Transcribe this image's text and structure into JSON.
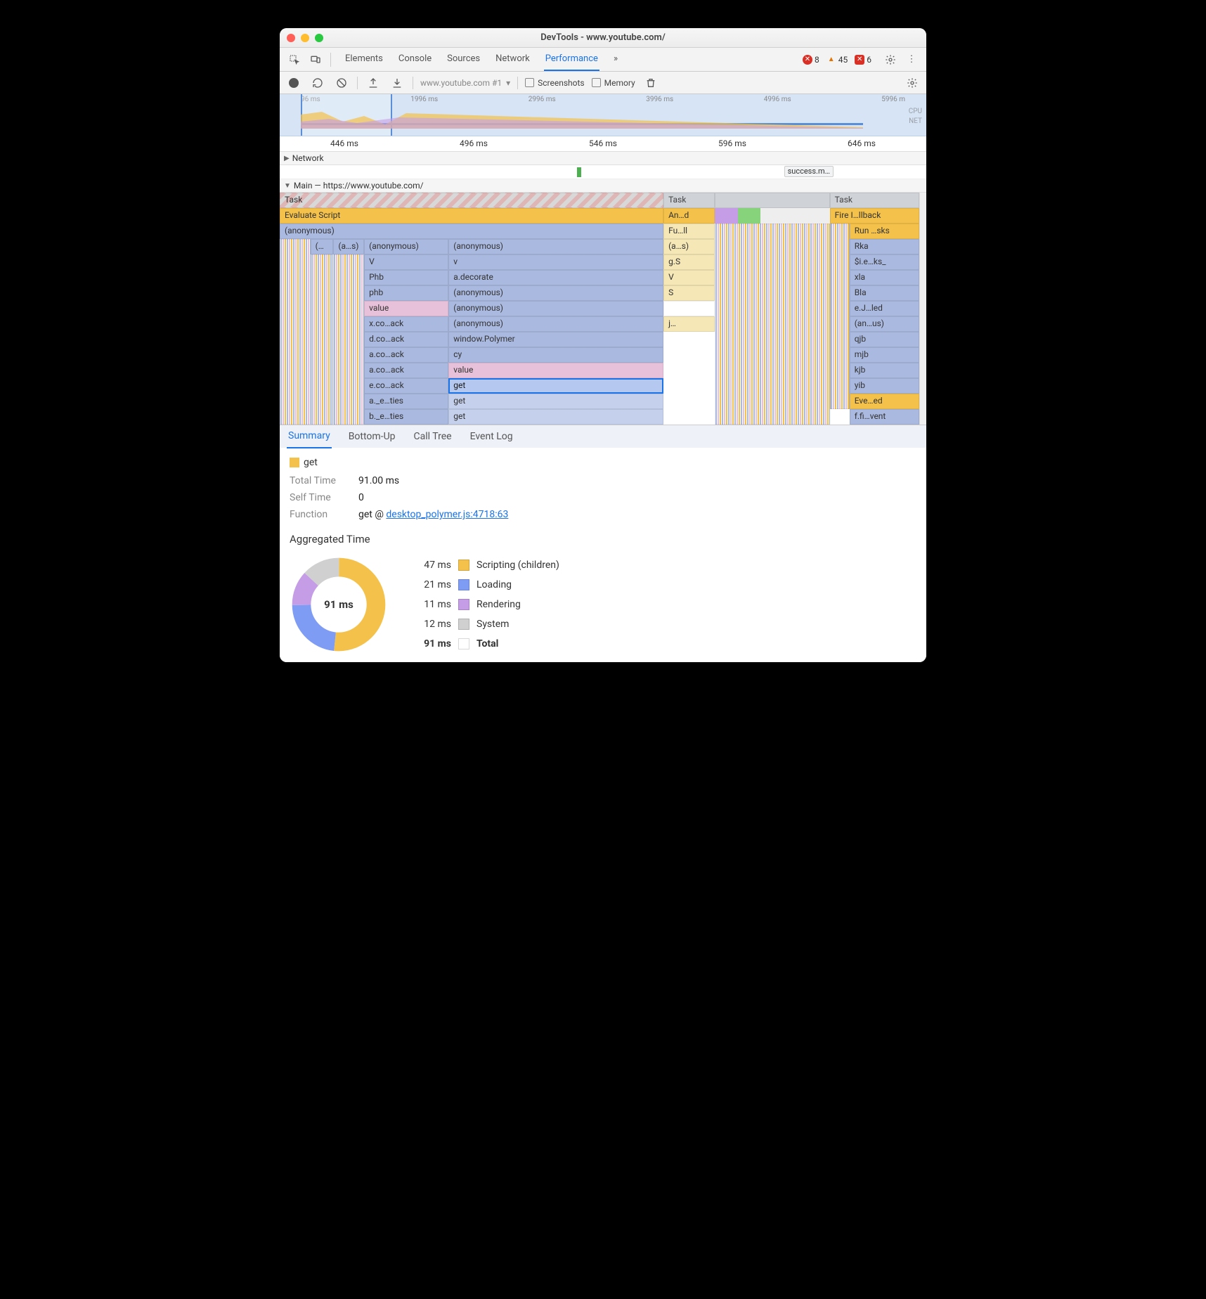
{
  "window": {
    "title": "DevTools - www.youtube.com/"
  },
  "tabs": {
    "items": [
      "Elements",
      "Console",
      "Sources",
      "Network",
      "Performance"
    ],
    "active": "Performance",
    "more": "»"
  },
  "badges": {
    "errors": "8",
    "warnings": "45",
    "console_errors": "6"
  },
  "toolbar": {
    "profile_name": "www.youtube.com #1",
    "screenshots_label": "Screenshots",
    "memory_label": "Memory"
  },
  "overview": {
    "ticks": [
      "96 ms",
      "1996 ms",
      "2996 ms",
      "3996 ms",
      "4996 ms",
      "5996 m"
    ],
    "cpu_label": "CPU",
    "net_label": "NET"
  },
  "ruler": {
    "ticks": [
      "446 ms",
      "496 ms",
      "546 ms",
      "596 ms",
      "646 ms"
    ]
  },
  "tracks": {
    "network_label": "Network",
    "main_label": "Main — https://www.youtube.com/",
    "network_chip": "success.m…"
  },
  "flame": {
    "col1": {
      "task": "Task",
      "eval": "Evaluate Script",
      "anon": "(anonymous)",
      "anon_short1": "(…",
      "anon_short2": "(a…s)",
      "stack_a": [
        {
          "label": "(anonymous)",
          "cls": "c-blue"
        },
        {
          "label": "V",
          "cls": "c-blue"
        },
        {
          "label": "Phb",
          "cls": "c-blue"
        },
        {
          "label": "phb",
          "cls": "c-blue"
        },
        {
          "label": "value",
          "cls": "c-pink"
        },
        {
          "label": "x.co…ack",
          "cls": "c-blue"
        },
        {
          "label": "d.co…ack",
          "cls": "c-blue"
        },
        {
          "label": "a.co…ack",
          "cls": "c-blue"
        },
        {
          "label": "a.co…ack",
          "cls": "c-blue"
        },
        {
          "label": "e.co…ack",
          "cls": "c-blue"
        },
        {
          "label": "a._e…ties",
          "cls": "c-blue"
        },
        {
          "label": "b._e…ties",
          "cls": "c-blue"
        }
      ],
      "stack_b": [
        {
          "label": "(anonymous)",
          "cls": "c-blue"
        },
        {
          "label": "v",
          "cls": "c-blue"
        },
        {
          "label": "a.decorate",
          "cls": "c-blue"
        },
        {
          "label": "(anonymous)",
          "cls": "c-blue"
        },
        {
          "label": "(anonymous)",
          "cls": "c-blue"
        },
        {
          "label": "(anonymous)",
          "cls": "c-blue"
        },
        {
          "label": "window.Polymer",
          "cls": "c-blue"
        },
        {
          "label": "cy",
          "cls": "c-blue"
        },
        {
          "label": "value",
          "cls": "c-pink"
        },
        {
          "label": "get",
          "cls": "c-sel"
        },
        {
          "label": "get",
          "cls": "c-lightblue"
        },
        {
          "label": "get",
          "cls": "c-lightblue"
        }
      ]
    },
    "col2": {
      "task": "Task",
      "and": "An…d",
      "full": "Fu…ll",
      "stack": [
        "(a…s)",
        "g.S",
        "V",
        "S"
      ],
      "j": "j…"
    },
    "col3": {
      "task": "Task",
      "fire": "Fire I…llback",
      "run": "Run …sks",
      "stack": [
        {
          "label": "Rka",
          "cls": "c-blue"
        },
        {
          "label": "$i.e…ks_",
          "cls": "c-blue"
        },
        {
          "label": "xla",
          "cls": "c-blue"
        },
        {
          "label": "Bla",
          "cls": "c-blue"
        },
        {
          "label": "e.J…led",
          "cls": "c-blue"
        },
        {
          "label": "(an…us)",
          "cls": "c-blue"
        },
        {
          "label": "qjb",
          "cls": "c-blue"
        },
        {
          "label": "mjb",
          "cls": "c-blue"
        },
        {
          "label": "kjb",
          "cls": "c-blue"
        },
        {
          "label": "yib",
          "cls": "c-blue"
        },
        {
          "label": "Eve…ed",
          "cls": "c-yellow"
        },
        {
          "label": "f.fi…vent",
          "cls": "c-blue"
        }
      ]
    }
  },
  "detail_tabs": {
    "items": [
      "Summary",
      "Bottom-Up",
      "Call Tree",
      "Event Log"
    ],
    "active": "Summary"
  },
  "summary": {
    "name": "get",
    "total_time_label": "Total Time",
    "total_time": "91.00 ms",
    "self_time_label": "Self Time",
    "self_time": "0",
    "function_label": "Function",
    "function_prefix": "get @ ",
    "function_link": "desktop_polymer.js:4718:63",
    "swatch_color": "#f4c24a"
  },
  "aggregated": {
    "title": "Aggregated Time",
    "center": "91 ms",
    "entries": [
      {
        "time": "47 ms",
        "color": "#f4c24a",
        "label": "Scripting (children)"
      },
      {
        "time": "21 ms",
        "color": "#7f9cf5",
        "label": "Loading"
      },
      {
        "time": "11 ms",
        "color": "#c49de6",
        "label": "Rendering"
      },
      {
        "time": "12 ms",
        "color": "#d0d0d0",
        "label": "System"
      }
    ],
    "total_time": "91 ms",
    "total_label": "Total"
  },
  "chart_data": {
    "type": "pie",
    "title": "Aggregated Time",
    "series": [
      {
        "name": "Scripting (children)",
        "value": 47,
        "color": "#f4c24a"
      },
      {
        "name": "Loading",
        "value": 21,
        "color": "#7f9cf5"
      },
      {
        "name": "Rendering",
        "value": 11,
        "color": "#c49de6"
      },
      {
        "name": "System",
        "value": 12,
        "color": "#d0d0d0"
      }
    ],
    "total": 91,
    "unit": "ms"
  }
}
